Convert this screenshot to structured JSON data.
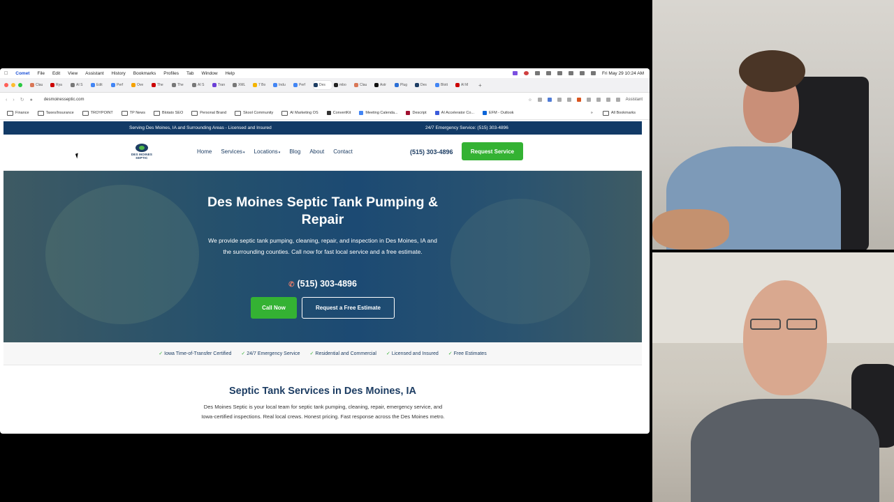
{
  "menubar": {
    "app_name": "Comet",
    "items": [
      "File",
      "Edit",
      "View",
      "Assistant",
      "History",
      "Bookmarks",
      "Profiles",
      "Tab",
      "Window",
      "Help"
    ],
    "datetime": "Fri May 29  10:24 AM"
  },
  "tabs": [
    {
      "label": "Clau",
      "color": "#d97757"
    },
    {
      "label": "Rya",
      "color": "#cc0000"
    },
    {
      "label": "AI S",
      "color": "#777777"
    },
    {
      "label": "Edit",
      "color": "#4285f4"
    },
    {
      "label": "Perf",
      "color": "#4285f4"
    },
    {
      "label": "Ove",
      "color": "#f4a100"
    },
    {
      "label": "The",
      "color": "#cc0000"
    },
    {
      "label": "The",
      "color": "#777777"
    },
    {
      "label": "AI S",
      "color": "#777777"
    },
    {
      "label": "Tran",
      "color": "#6b3fd6"
    },
    {
      "label": "XML",
      "color": "#777777"
    },
    {
      "label": "7 Bo",
      "color": "#f4b400"
    },
    {
      "label": "Indu",
      "color": "#4285f4"
    },
    {
      "label": "Perf",
      "color": "#4285f4"
    },
    {
      "label": "Des",
      "color": "#1d3d63",
      "active": true
    },
    {
      "label": "mbo",
      "color": "#222222"
    },
    {
      "label": "Clau",
      "color": "#d97757"
    },
    {
      "label": "Astr",
      "color": "#111111"
    },
    {
      "label": "Plug",
      "color": "#2b6fd6"
    },
    {
      "label": "Des",
      "color": "#1d3d63"
    },
    {
      "label": "Blott",
      "color": "#4285f4"
    },
    {
      "label": "AI M",
      "color": "#cc0000"
    }
  ],
  "toolbar": {
    "url": "desmoinesseptic.com",
    "assistant_label": "Assistant"
  },
  "bookmarks": [
    {
      "label": "Finance",
      "type": "folder"
    },
    {
      "label": "Taxes/Insurance",
      "type": "folder"
    },
    {
      "label": "TROYPOINT",
      "type": "folder"
    },
    {
      "label": "TP News",
      "type": "folder"
    },
    {
      "label": "Blotato SEO",
      "type": "folder"
    },
    {
      "label": "Personal Brand",
      "type": "folder"
    },
    {
      "label": "Skool Community",
      "type": "folder"
    },
    {
      "label": "AI Marketing OS",
      "type": "folder"
    },
    {
      "label": "ConvertKit",
      "type": "site",
      "color": "#333333"
    },
    {
      "label": "Meeting Calenda...",
      "type": "site",
      "color": "#4285f4"
    },
    {
      "label": "Descript",
      "type": "site",
      "color": "#a01030"
    },
    {
      "label": "AI Accelerator Co...",
      "type": "site",
      "color": "#3b5bdb"
    },
    {
      "label": "EFM - Outlook",
      "type": "site",
      "color": "#0a64d8"
    }
  ],
  "bookmarks_more": "»",
  "bookmarks_all": "All Bookmarks",
  "site": {
    "topbar_left": "Serving Des Moines, IA and Surrounding Areas - Licensed and Insured",
    "topbar_right": "24/7 Emergency Service: (515) 303-4896",
    "logo_text": "DES MOINES SEPTIC",
    "nav": {
      "home": "Home",
      "services": "Services",
      "locations": "Locations",
      "blog": "Blog",
      "about": "About",
      "contact": "Contact"
    },
    "header_phone": "(515) 303-4896",
    "request_service": "Request Service",
    "hero": {
      "title_line1": "Des Moines Septic Tank Pumping &",
      "title_line2": "Repair",
      "description": "We provide septic tank pumping, cleaning, repair, and inspection in Des Moines, IA and the surrounding counties. Call now for fast local service and a free estimate.",
      "phone": "(515) 303-4896",
      "call_now": "Call Now",
      "free_estimate": "Request a Free Estimate"
    },
    "badges": [
      "Iowa Time-of-Transfer Certified",
      "24/7 Emergency Service",
      "Residential and Commercial",
      "Licensed and Insured",
      "Free Estimates"
    ],
    "section_title": "Septic Tank Services in Des Moines, IA",
    "section_desc": "Des Moines Septic is your local team for septic tank pumping, cleaning, repair, emergency service, and Iowa-certified inspections. Real local crews. Honest pricing. Fast response across the Des Moines metro."
  },
  "colors": {
    "navy": "#1d3d63",
    "green": "#34b233",
    "topbar": "#123a66"
  }
}
